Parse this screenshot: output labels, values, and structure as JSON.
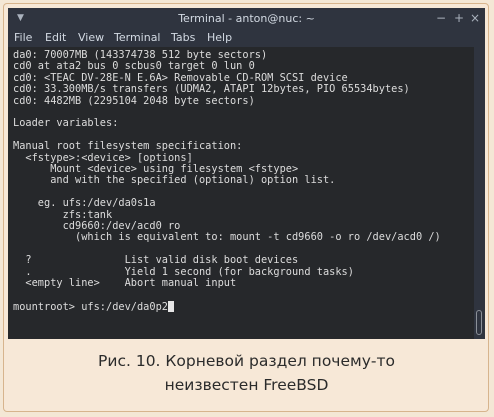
{
  "window": {
    "title": "Terminal - anton@nuc: ~",
    "controls": {
      "minimize": "−",
      "maximize": "+",
      "close": "×"
    },
    "menu_icon": "▼"
  },
  "menubar": [
    "File",
    "Edit",
    "View",
    "Terminal",
    "Tabs",
    "Help"
  ],
  "terminal": {
    "lines": [
      "da0: 70007MB (143374738 512 byte sectors)",
      "cd0 at ata2 bus 0 scbus0 target 0 lun 0",
      "cd0: <TEAC DV-28E-N E.6A> Removable CD-ROM SCSI device",
      "cd0: 33.300MB/s transfers (UDMA2, ATAPI 12bytes, PIO 65534bytes)",
      "cd0: 4482MB (2295104 2048 byte sectors)",
      "",
      "Loader variables:",
      "",
      "Manual root filesystem specification:",
      "  <fstype>:<device> [options]",
      "      Mount <device> using filesystem <fstype>",
      "      and with the specified (optional) option list.",
      "",
      "    eg. ufs:/dev/da0s1a",
      "        zfs:tank",
      "        cd9660:/dev/acd0 ro",
      "          (which is equivalent to: mount -t cd9660 -o ro /dev/acd0 /)",
      "",
      "  ?               List valid disk boot devices",
      "  .               Yield 1 second (for background tasks)",
      "  <empty line>    Abort manual input",
      ""
    ],
    "prompt": "mountroot> ufs:/dev/da0p2"
  },
  "caption": {
    "line1": "Рис. 10. Корневой раздел почему-то",
    "line2": "неизвестен FreeBSD"
  }
}
